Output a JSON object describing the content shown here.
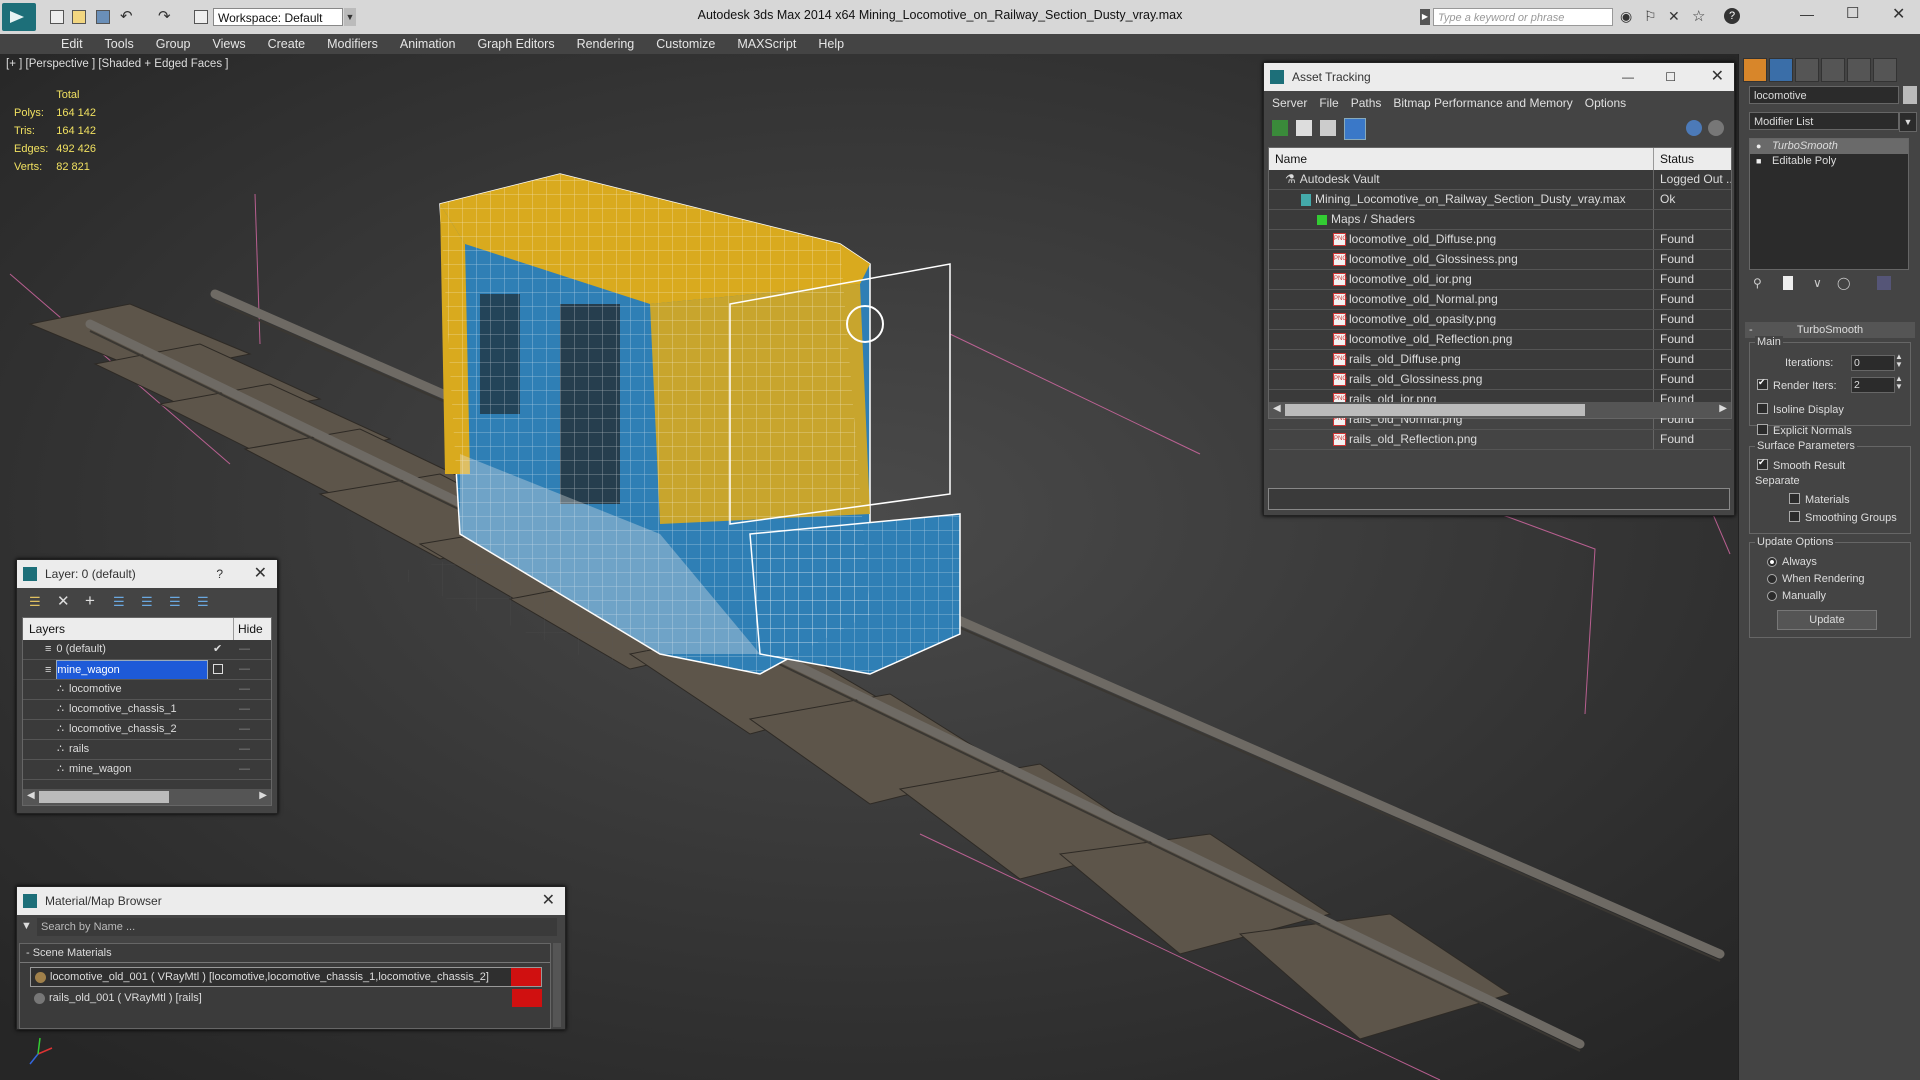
{
  "app": {
    "title": "Autodesk 3ds Max  2014 x64      Mining_Locomotive_on_Railway_Section_Dusty_vray.max",
    "workspace": "Workspace: Default",
    "search_placeholder": "Type a keyword or phrase"
  },
  "menu": [
    "Edit",
    "Tools",
    "Group",
    "Views",
    "Create",
    "Modifiers",
    "Animation",
    "Graph Editors",
    "Rendering",
    "Customize",
    "MAXScript",
    "Help"
  ],
  "viewport": {
    "label": "[+ ] [Perspective ] [Shaded + Edged Faces ]",
    "stats": {
      "header": "Total",
      "rows": [
        {
          "label": "Polys:",
          "value": "164 142"
        },
        {
          "label": "Tris:",
          "value": "164 142"
        },
        {
          "label": "Edges:",
          "value": "492 426"
        },
        {
          "label": "Verts:",
          "value": "82 821"
        }
      ]
    }
  },
  "asset_tracking": {
    "title": "Asset Tracking",
    "menu": [
      "Server",
      "File",
      "Paths",
      "Bitmap Performance and Memory",
      "Options"
    ],
    "col_name": "Name",
    "col_status": "Status",
    "rows": [
      {
        "name": "Autodesk Vault",
        "status": "Logged Out ...",
        "indent": 1,
        "icon": "vault"
      },
      {
        "name": "Mining_Locomotive_on_Railway_Section_Dusty_vray.max",
        "status": "Ok",
        "indent": 2,
        "icon": "max"
      },
      {
        "name": "Maps / Shaders",
        "status": "",
        "indent": 3,
        "icon": "maps"
      },
      {
        "name": "locomotive_old_Diffuse.png",
        "status": "Found",
        "indent": 4,
        "icon": "png"
      },
      {
        "name": "locomotive_old_Glossiness.png",
        "status": "Found",
        "indent": 4,
        "icon": "png"
      },
      {
        "name": "locomotive_old_ior.png",
        "status": "Found",
        "indent": 4,
        "icon": "png"
      },
      {
        "name": "locomotive_old_Normal.png",
        "status": "Found",
        "indent": 4,
        "icon": "png"
      },
      {
        "name": "locomotive_old_opasity.png",
        "status": "Found",
        "indent": 4,
        "icon": "png"
      },
      {
        "name": "locomotive_old_Reflection.png",
        "status": "Found",
        "indent": 4,
        "icon": "png"
      },
      {
        "name": "rails_old_Diffuse.png",
        "status": "Found",
        "indent": 4,
        "icon": "png"
      },
      {
        "name": "rails_old_Glossiness.png",
        "status": "Found",
        "indent": 4,
        "icon": "png"
      },
      {
        "name": "rails_old_ior.png",
        "status": "Found",
        "indent": 4,
        "icon": "png"
      },
      {
        "name": "rails_old_Normal.png",
        "status": "Found",
        "indent": 4,
        "icon": "png"
      },
      {
        "name": "rails_old_Reflection.png",
        "status": "Found",
        "indent": 4,
        "icon": "png"
      }
    ]
  },
  "layer_panel": {
    "title": "Layer: 0 (default)",
    "help": "?",
    "col_layers": "Layers",
    "col_hide": "Hide",
    "rows": [
      {
        "name": "0 (default)",
        "selected": false,
        "indent": 1
      },
      {
        "name": "mine_wagon",
        "selected": true,
        "indent": 1
      },
      {
        "name": "locomotive",
        "selected": false,
        "indent": 2
      },
      {
        "name": "locomotive_chassis_1",
        "selected": false,
        "indent": 2
      },
      {
        "name": "locomotive_chassis_2",
        "selected": false,
        "indent": 2
      },
      {
        "name": "rails",
        "selected": false,
        "indent": 2
      },
      {
        "name": "mine_wagon",
        "selected": false,
        "indent": 2
      }
    ]
  },
  "material_browser": {
    "title": "Material/Map Browser",
    "search_placeholder": "Search by Name ...",
    "section": "- Scene Materials",
    "items": [
      "locomotive_old_001 ( VRayMtl ) [locomotive,locomotive_chassis_1,locomotive_chassis_2]",
      "rails_old_001  ( VRayMtl ) [rails]"
    ]
  },
  "command_panel": {
    "object_name": "locomotive",
    "modifier_list": "Modifier List",
    "stack": [
      "TurboSmooth",
      "Editable Poly"
    ],
    "rollout_title": "TurboSmooth",
    "main_group": "Main",
    "iterations_label": "Iterations:",
    "iterations_value": "0",
    "render_iters_label": "Render Iters:",
    "render_iters_value": "2",
    "isoline_display": "Isoline Display",
    "explicit_normals": "Explicit Normals",
    "surface_params": "Surface Parameters",
    "smooth_result": "Smooth Result",
    "separate": "Separate",
    "materials": "Materials",
    "smoothing_groups": "Smoothing Groups",
    "update_options": "Update Options",
    "always": "Always",
    "when_rendering": "When Rendering",
    "manually": "Manually",
    "update_button": "Update"
  }
}
